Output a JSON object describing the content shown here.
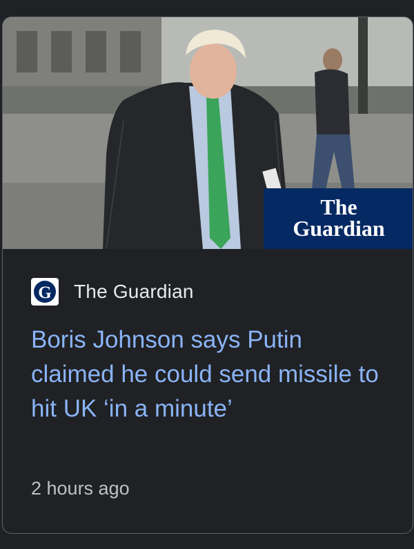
{
  "card": {
    "image_alt": "Photo of Boris Johnson in a dark quilted jacket and green tie",
    "watermark_line1": "The",
    "watermark_line2": "Guardian",
    "publisher_logo_letter": "G",
    "publisher": "The Guardian",
    "headline": "Boris Johnson says Putin claimed he could send missile to hit UK ‘in a minute’",
    "time": "2 hours ago"
  },
  "colors": {
    "background": "#202124",
    "headline": "#8ab4f8",
    "guardian_blue": "#052962"
  }
}
